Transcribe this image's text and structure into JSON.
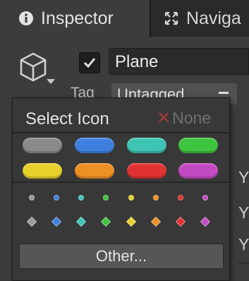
{
  "tabs": [
    {
      "label": "Inspector",
      "icon": "info-icon"
    },
    {
      "label": "Naviga",
      "icon": "navigation-icon"
    }
  ],
  "gameobject": {
    "name": "Plane",
    "active": true,
    "tag_label": "Tag",
    "tag_value": "Untagged"
  },
  "side_labels": [
    "Y",
    "Y",
    "Y"
  ],
  "icon_popup": {
    "title": "Select Icon",
    "none_label": "None",
    "label_colors": [
      "#8a8a8a",
      "#3f7fe0",
      "#3fc4b4",
      "#3ec43e",
      "#e6d02a",
      "#ee8f24",
      "#e03232",
      "#c44ac4"
    ],
    "dot_colors": [
      "#9a9a9a",
      "#3f7fe0",
      "#3fc4b4",
      "#3ec43e",
      "#e6d02a",
      "#ee8f24",
      "#e03232",
      "#c44ac4"
    ],
    "other_label": "Other..."
  }
}
